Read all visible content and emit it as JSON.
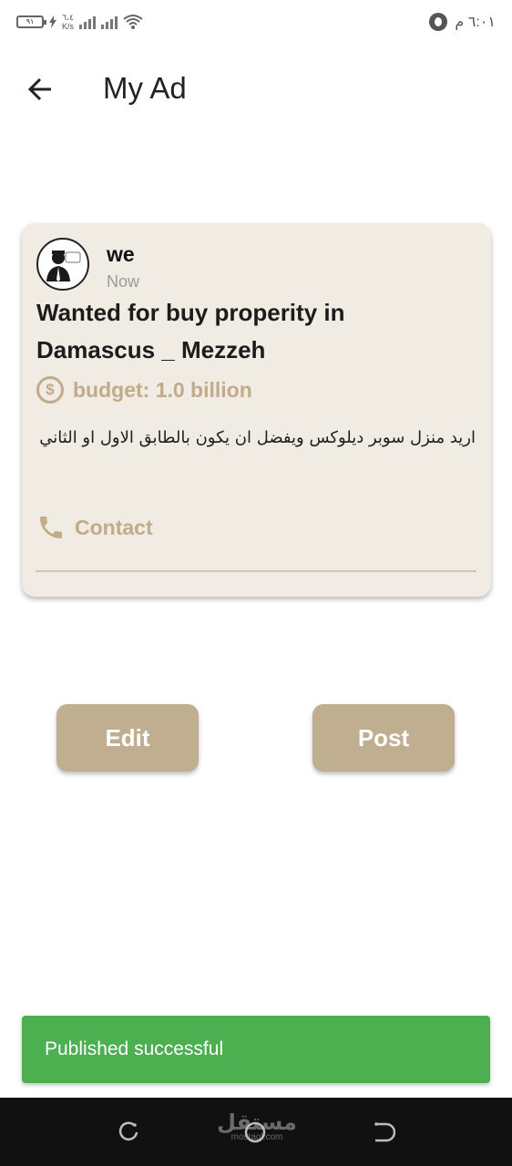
{
  "status_bar": {
    "battery": "٩١",
    "net_speed_value": "٦،٤",
    "net_speed_unit": "K/s",
    "time": "٦:٠١ م"
  },
  "app_bar": {
    "title": "My Ad",
    "back_icon": "arrow-left-icon"
  },
  "ad": {
    "username": "we",
    "time": "Now",
    "title": "Wanted for buy properity in Damascus _ Mezzeh",
    "budget_label": "budget: 1.0 billion",
    "budget_icon": "dollar-circle-icon",
    "description": "اريد منزل سوبر ديلوكس ويفضل ان يكون بالطابق الاول او الثاني",
    "contact_label": "Contact",
    "contact_icon": "phone-icon"
  },
  "actions": {
    "edit_label": "Edit",
    "post_label": "Post"
  },
  "snackbar": {
    "message": "Published successful"
  },
  "nav_bar": {
    "watermark": "مستقل",
    "watermark_sub": "mostaql.com"
  },
  "colors": {
    "accent": "#bfae8f",
    "card_bg": "#f0ebe3",
    "success": "#4caf50"
  }
}
